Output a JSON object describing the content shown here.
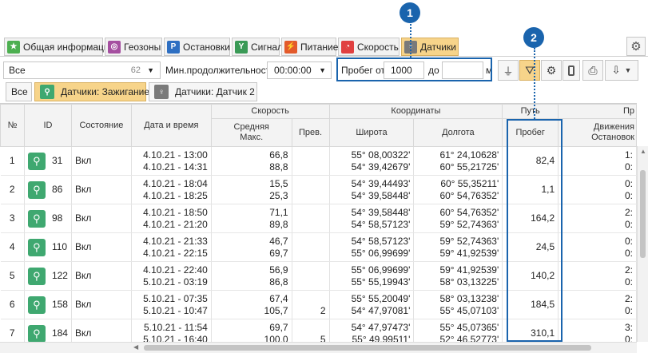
{
  "tabs": [
    {
      "label": "Общая информация",
      "icon": "star-icon"
    },
    {
      "label": "Геозоны",
      "icon": "geozone-icon"
    },
    {
      "label": "Остановки",
      "icon": "parking-icon"
    },
    {
      "label": "Сигнал",
      "icon": "signal-icon"
    },
    {
      "label": "Питание",
      "icon": "power-icon"
    },
    {
      "label": "Скорость",
      "icon": "speedometer-icon"
    },
    {
      "label": "Датчики",
      "icon": "sensor-icon"
    }
  ],
  "filter": {
    "select_value": "Все",
    "select_count": "62",
    "min_duration_label": "Мин.продолжительность",
    "min_duration_value": "00:00:00",
    "mileage_from_label": "Пробег от",
    "mileage_from_value": "1000",
    "mileage_to_label": "до",
    "mileage_to_value": "",
    "unit": "м"
  },
  "subtabs": [
    {
      "label": "Все"
    },
    {
      "label": "Датчики: Зажигание"
    },
    {
      "label": "Датчики: Датчик 2"
    }
  ],
  "headers": {
    "num": "№",
    "id": "ID",
    "state": "Состояние",
    "datetime": "Дата и время",
    "speed_group": "Скорость",
    "speed_avg": "Средняя",
    "speed_max": "Макс.",
    "speed_over": "Прев.",
    "coords_group": "Координаты",
    "lat": "Широта",
    "lon": "Долгота",
    "path_group": "Путь",
    "mileage": "Пробег",
    "pr_group": "Пр",
    "move": "Движения",
    "stops": "Остановок"
  },
  "rows": [
    {
      "n": "1",
      "id": "31",
      "state": "Вкл",
      "dt1": "4.10.21 - 13:00",
      "dt2": "4.10.21 - 14:31",
      "s1": "66,8",
      "s2": "88,8",
      "over": "",
      "lat1": "55° 08,00322'",
      "lat2": "54° 39,42679'",
      "lon1": "61° 24,10628'",
      "lon2": "60° 55,21725'",
      "mileage": "82,4",
      "m1": "1:",
      "m2": "0:"
    },
    {
      "n": "2",
      "id": "86",
      "state": "Вкл",
      "dt1": "4.10.21 - 18:04",
      "dt2": "4.10.21 - 18:25",
      "s1": "15,5",
      "s2": "25,3",
      "over": "",
      "lat1": "54° 39,44493'",
      "lat2": "54° 39,58448'",
      "lon1": "60° 55,35211'",
      "lon2": "60° 54,76352'",
      "mileage": "1,1",
      "m1": "0:",
      "m2": "0:"
    },
    {
      "n": "3",
      "id": "98",
      "state": "Вкл",
      "dt1": "4.10.21 - 18:50",
      "dt2": "4.10.21 - 21:20",
      "s1": "71,1",
      "s2": "89,8",
      "over": "",
      "lat1": "54° 39,58448'",
      "lat2": "54° 58,57123'",
      "lon1": "60° 54,76352'",
      "lon2": "59° 52,74363'",
      "mileage": "164,2",
      "m1": "2:",
      "m2": "0:"
    },
    {
      "n": "4",
      "id": "110",
      "state": "Вкл",
      "dt1": "4.10.21 - 21:33",
      "dt2": "4.10.21 - 22:15",
      "s1": "46,7",
      "s2": "69,7",
      "over": "",
      "lat1": "54° 58,57123'",
      "lat2": "55° 06,99699'",
      "lon1": "59° 52,74363'",
      "lon2": "59° 41,92539'",
      "mileage": "24,5",
      "m1": "0:",
      "m2": "0:"
    },
    {
      "n": "5",
      "id": "122",
      "state": "Вкл",
      "dt1": "4.10.21 - 22:40",
      "dt2": "5.10.21 - 03:19",
      "s1": "56,9",
      "s2": "86,8",
      "over": "",
      "lat1": "55° 06,99699'",
      "lat2": "55° 55,19943'",
      "lon1": "59° 41,92539'",
      "lon2": "58° 03,13225'",
      "mileage": "140,2",
      "m1": "2:",
      "m2": "0:"
    },
    {
      "n": "6",
      "id": "158",
      "state": "Вкл",
      "dt1": "5.10.21 - 07:35",
      "dt2": "5.10.21 - 10:47",
      "s1": "67,4",
      "s2": "105,7",
      "over": "2",
      "lat1": "55° 55,20049'",
      "lat2": "54° 47,97081'",
      "lon1": "58° 03,13238'",
      "lon2": "55° 45,07103'",
      "mileage": "184,5",
      "m1": "2:",
      "m2": "0:"
    },
    {
      "n": "7",
      "id": "184",
      "state": "Вкл",
      "dt1": "5.10.21 - 11:54",
      "dt2": "5.10.21 - 16:40",
      "s1": "69,7",
      "s2": "100,0",
      "over": "5",
      "lat1": "54° 47,97473'",
      "lat2": "55° 49,99511'",
      "lon1": "55° 45,07365'",
      "lon2": "52° 46,52773'",
      "mileage": "310,1",
      "m1": "3:",
      "m2": "0:"
    }
  ],
  "callouts": [
    "1",
    "2"
  ],
  "colors": {
    "accent": "#1a64ad",
    "active_tab": "#f7d48a",
    "sensor_green": "#3fa870"
  }
}
